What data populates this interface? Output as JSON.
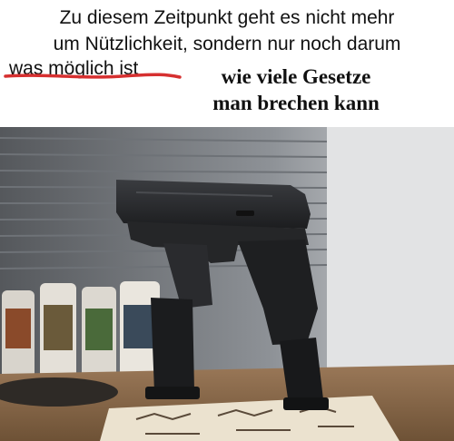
{
  "caption": {
    "line1": "Zu diesem Zeitpunkt geht es nicht mehr",
    "line2": "um Nützlichkeit, sondern nur noch darum",
    "line3": "was möglich ist",
    "addition_line1": "wie viele Gesetze",
    "addition_line2": "man brechen kann"
  },
  "colors": {
    "strike": "#d63030",
    "wall": "#cfd2d6",
    "blinds": "#8a8e94",
    "pistol": "#1f2022",
    "desk": "#8a6a4a",
    "mat": "#e8ddc8"
  }
}
